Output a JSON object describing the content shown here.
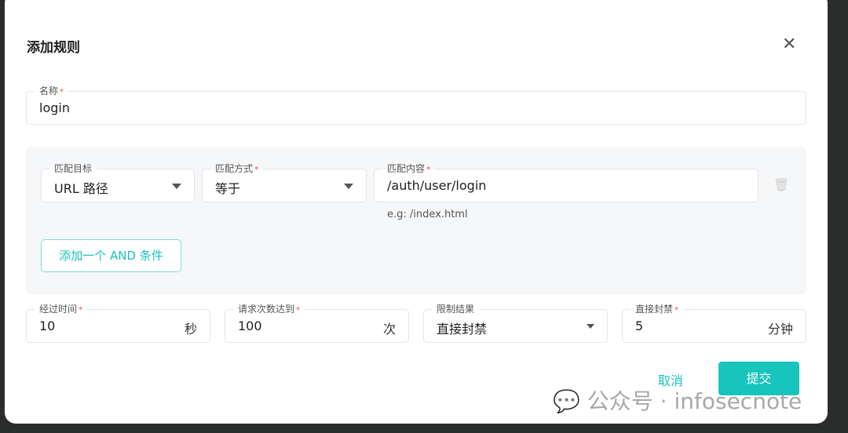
{
  "dialog": {
    "title": "添加规则"
  },
  "name": {
    "label": "名称",
    "value": "login"
  },
  "condition": {
    "target": {
      "label": "匹配目标",
      "value": "URL 路径"
    },
    "method": {
      "label": "匹配方式",
      "value": "等于"
    },
    "content": {
      "label": "匹配内容",
      "value": "/auth/user/login",
      "hint": "e.g: /index.html"
    },
    "add_and": "添加一个 AND 条件"
  },
  "limits": {
    "time": {
      "label": "经过时间",
      "value": "10",
      "suffix": "秒"
    },
    "count": {
      "label": "请求次数达到",
      "value": "100",
      "suffix": "次"
    },
    "result": {
      "label": "限制结果",
      "value": "直接封禁"
    },
    "ban": {
      "label": "直接封禁",
      "value": "5",
      "suffix": "分钟"
    }
  },
  "actions": {
    "cancel": "取消",
    "submit": "提交"
  },
  "watermark": "公众号 · infosecnote"
}
